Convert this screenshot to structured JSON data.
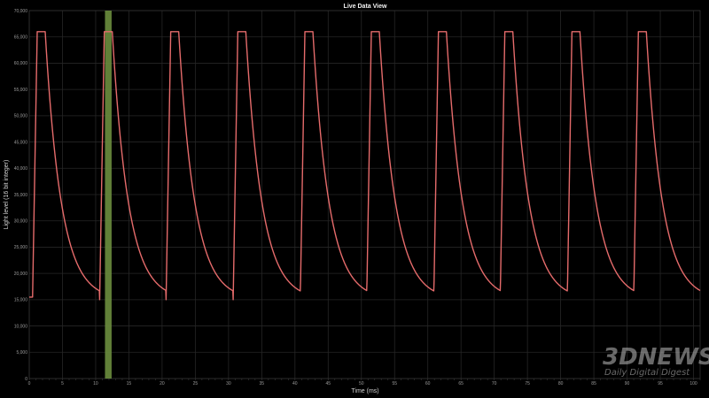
{
  "chart_data": {
    "type": "line",
    "title": "Live Data View",
    "xlabel": "Time (ms)",
    "ylabel": "Light level (16 bit integer)",
    "xlim": [
      0,
      101
    ],
    "ylim": [
      0,
      70000
    ],
    "x_ticks": [
      0,
      5,
      10,
      15,
      20,
      25,
      30,
      35,
      40,
      45,
      50,
      55,
      60,
      65,
      70,
      75,
      80,
      85,
      90,
      95,
      100
    ],
    "y_ticks": [
      0,
      5000,
      10000,
      15000,
      20000,
      25000,
      30000,
      35000,
      40000,
      45000,
      50000,
      55000,
      60000,
      65000,
      70000
    ],
    "x_tick_labels": [
      "0",
      "5",
      "10",
      "15",
      "20",
      "25",
      "30",
      "35",
      "40",
      "45",
      "50",
      "55",
      "60",
      "65",
      "70",
      "75",
      "80",
      "85",
      "90",
      "95",
      "100"
    ],
    "y_tick_labels": [
      "0",
      "5,000",
      "10,000",
      "15,000",
      "20,000",
      "25,000",
      "30,000",
      "35,000",
      "40,000",
      "45,000",
      "50,000",
      "55,000",
      "60,000",
      "65,000",
      "70,000"
    ],
    "grid": true,
    "series_color": "#e56b6b",
    "series": [
      {
        "pulse_starts_ms": [
          0.5,
          10.6,
          20.6,
          30.7,
          40.8,
          50.8,
          60.9,
          70.9,
          81.0,
          91.0
        ],
        "peak_value": 66000,
        "baseline_value": 15000,
        "rise_ms": 0.7,
        "peak_hold_ms": 1.2,
        "decay_time_constant_ms": 2.4,
        "initial_value": 15500
      }
    ],
    "highlight_band": {
      "x_start": 11.4,
      "x_end": 12.4,
      "color": "#6b8e3e"
    }
  },
  "watermark": {
    "main": "3DNEWS",
    "sub": "Daily Digital Digest"
  }
}
